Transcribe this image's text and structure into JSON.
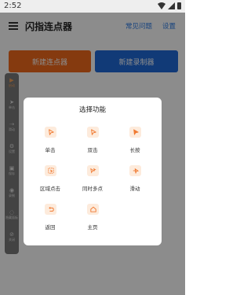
{
  "status_bar": {
    "time": "2:52"
  },
  "app_bar": {
    "title": "闪指连点器",
    "faq": "常见问题",
    "settings": "设置"
  },
  "main": {
    "new_clicker": "新建连点器",
    "new_recorder": "新建录制器"
  },
  "side_toolbar": {
    "items": [
      {
        "icon": "play-icon",
        "label": "启动"
      },
      {
        "icon": "cursor-icon",
        "label": "单击"
      },
      {
        "icon": "swipe-icon",
        "label": "滑动"
      },
      {
        "icon": "gear-icon",
        "label": "设置"
      },
      {
        "icon": "save-icon",
        "label": "保存"
      },
      {
        "icon": "record-icon",
        "label": "录制"
      },
      {
        "icon": "hide-icon",
        "label": "隐藏面板"
      },
      {
        "icon": "close-icon",
        "label": "关闭"
      }
    ]
  },
  "dialog": {
    "title": "选择功能",
    "functions": [
      {
        "icon": "tap-icon",
        "label": "单击"
      },
      {
        "icon": "double-tap-icon",
        "label": "双击"
      },
      {
        "icon": "long-press-icon",
        "label": "长按"
      },
      {
        "icon": "area-tap-icon",
        "label": "区域点击"
      },
      {
        "icon": "multi-point-icon",
        "label": "同时多点"
      },
      {
        "icon": "swipe-icon",
        "label": "滑动"
      },
      {
        "icon": "back-icon",
        "label": "返回"
      },
      {
        "icon": "home-icon",
        "label": "主页"
      }
    ]
  },
  "colors": {
    "orange": "#f26b1d",
    "blue": "#1f6ad9",
    "link": "#2c7be5",
    "tile_bg": "#fdebdc",
    "icon": "#f07a32"
  }
}
